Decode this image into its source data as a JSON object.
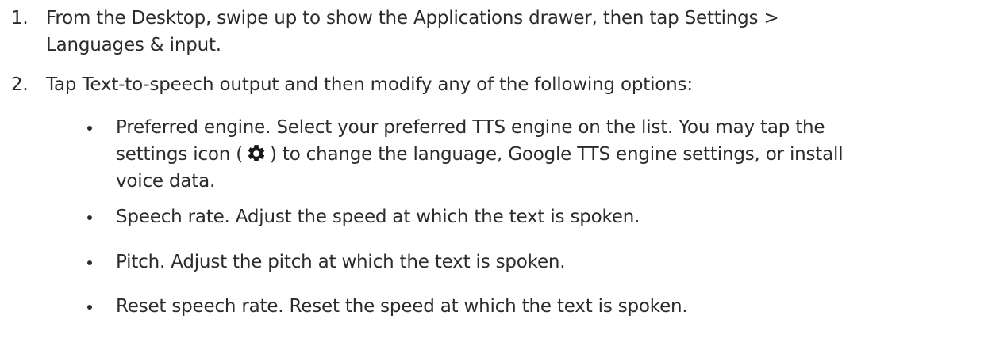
{
  "steps": [
    {
      "number": "1.",
      "lines": [
        "From the Desktop, swipe up to show the Applications drawer, then tap Settings >",
        "Languages & input."
      ]
    },
    {
      "number": "2.",
      "lines": [
        "Tap Text-to-speech output and then modify any of the following options:"
      ]
    }
  ],
  "bullets": [
    {
      "line1": "Preferred engine. Select your preferred TTS engine on the list. You may tap the",
      "line2_before_icon": "settings icon (",
      "line2_after_icon": ") to change the language, Google TTS engine settings, or install",
      "line3": "voice data.",
      "icon": "gear-icon"
    },
    {
      "text": "Speech rate. Adjust the speed at which the text is spoken."
    },
    {
      "text": "Pitch. Adjust the pitch at which the text is spoken."
    },
    {
      "text": "Reset speech rate. Reset the speed at which the text is spoken."
    }
  ]
}
